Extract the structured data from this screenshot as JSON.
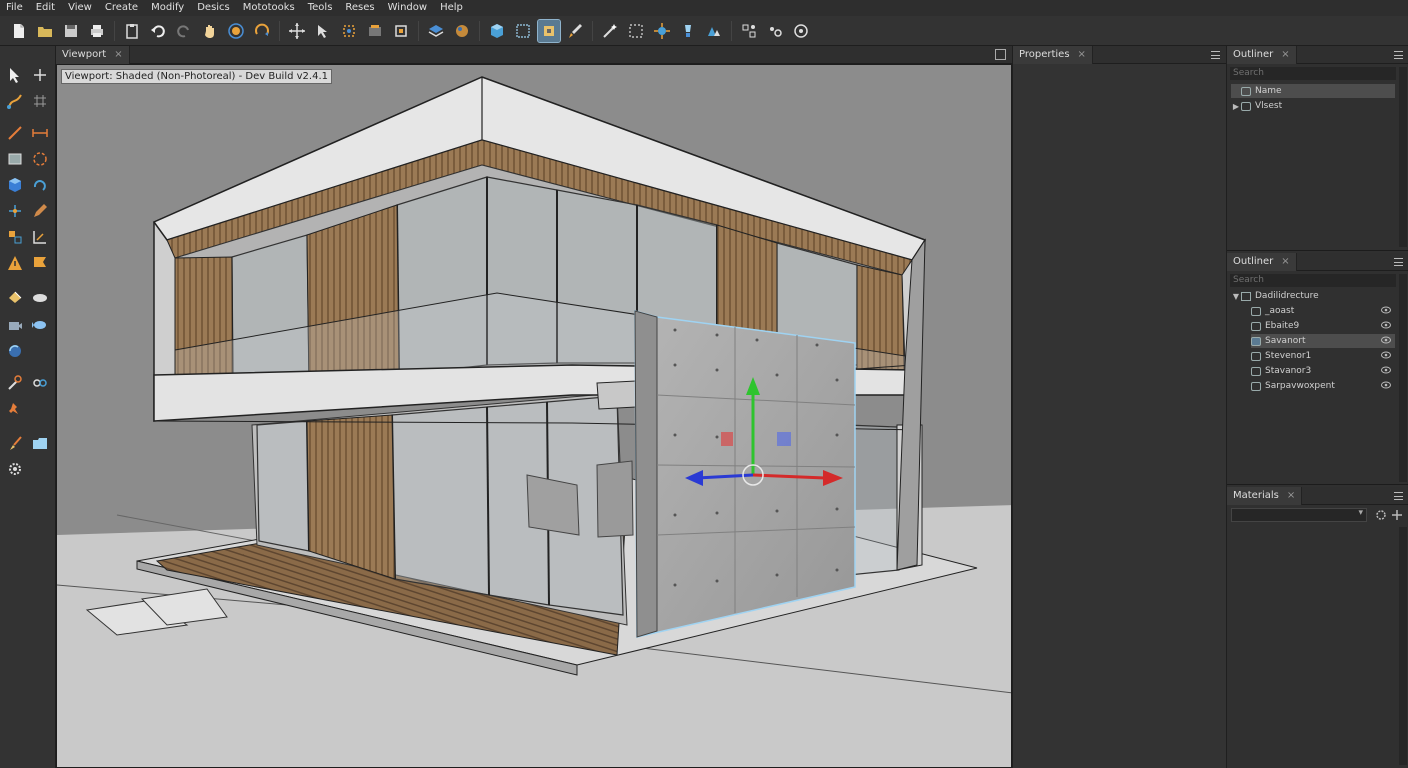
{
  "menu": [
    "File",
    "Edit",
    "View",
    "Create",
    "Modify",
    "Desics",
    "Mototooks",
    "Teols",
    "Reses",
    "Window",
    "Help"
  ],
  "viewport": {
    "tab_label": "Viewport",
    "close_glyph": "×",
    "overlay_label": "Viewport: Shaded (Non-Photoreal) - Dev Build v2.4.1"
  },
  "properties": {
    "tab_label": "Properties",
    "close_glyph": "×"
  },
  "outliner_top": {
    "tab_label": "Outliner",
    "close_glyph": "×",
    "search_placeholder": "Search",
    "rows": [
      {
        "label": "Name",
        "selected": true
      },
      {
        "label": "Vlsest",
        "selected": false
      }
    ]
  },
  "outliner_bottom": {
    "tab_label": "Outliner",
    "search_placeholder": "Search",
    "root": "Dadilidrecture",
    "rows": [
      {
        "label": "_aoast",
        "selected": false
      },
      {
        "label": "Ebaite9",
        "selected": false
      },
      {
        "label": "Savanort",
        "selected": true
      },
      {
        "label": "Stevenor1",
        "selected": false
      },
      {
        "label": "Stavanor3",
        "selected": false
      },
      {
        "label": "Sarpavwoxpent",
        "selected": false
      }
    ]
  },
  "materials": {
    "tab_label": "Materials",
    "close_glyph": "×"
  },
  "colors": {
    "accent": "#5a7a92",
    "gizmo_x": "#d42a2a",
    "gizmo_y": "#2ec42e",
    "gizmo_z": "#2a3ad4",
    "wood": "#9b7a55",
    "concrete": "#a9a9a9"
  },
  "icons": {
    "toolbar": [
      "new-file-icon",
      "open-folder-icon",
      "save-icon",
      "print-icon",
      "clipboard-icon",
      "undo-icon",
      "redo-icon",
      "hand-pan-icon",
      "orbit-icon",
      "rotate-view-icon",
      "move-icon",
      "select-dropdown-icon",
      "snap-icon",
      "render-icon",
      "component-dropdown-icon",
      "layers-icon",
      "material-icon",
      "cube-view-icon",
      "grid-icon",
      "select-box-icon",
      "paint-icon",
      "magic-wand-icon",
      "marquee-icon",
      "sparkle-icon",
      "light-icon",
      "group-icon",
      "settings-icon",
      "camera-icon",
      "target-icon"
    ],
    "left": [
      "select-arrow-icon",
      "move-cross-icon",
      "pen-icon",
      "grid-snap-icon",
      "line-icon",
      "dimension-icon",
      "rectangle-icon",
      "circle-icon",
      "box-icon",
      "rotate-icon",
      "point-icon",
      "pencil-icon",
      "scale-icon",
      "measure-icon",
      "warning-icon",
      "flag-icon",
      "paint-bucket-icon",
      "eraser-icon",
      "camera-tool-icon",
      "fish-icon",
      "sphere-tool-icon",
      "wrench-icon",
      "link-icon",
      "pin-icon",
      "brush-icon",
      "folder-tool-icon",
      "gear-tool-icon"
    ]
  }
}
